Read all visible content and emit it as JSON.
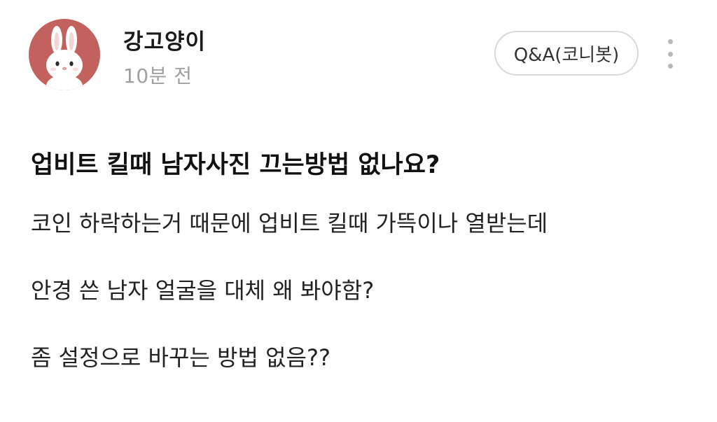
{
  "post": {
    "author": {
      "name": "강고양이",
      "avatar_icon": "bunny-avatar-icon",
      "avatar_bg": "#c2615e"
    },
    "time": "10분 전",
    "category": "Q&A(코니봇)",
    "menu_icon": "more-vertical-icon",
    "title": "업비트 킬때 남자사진 끄는방법 없나요?",
    "body": [
      "코인 하락하는거 때문에 업비트 킬때 가뜩이나 열받는데",
      "안경 쓴 남자 얼굴을 대체 왜 봐야함?",
      "좀 설정으로 바꾸는 방법 없음??"
    ]
  }
}
